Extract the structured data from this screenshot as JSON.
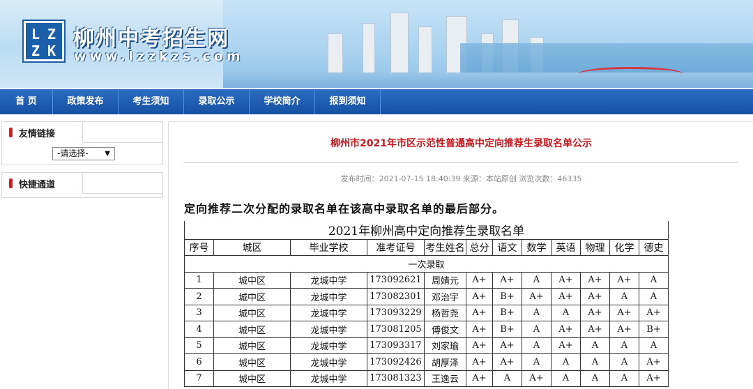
{
  "header": {
    "logo_letters": [
      "L",
      "Z",
      "Z",
      "K"
    ],
    "site_title": "柳州中考招生网",
    "site_url": "www.lzzkzs.com"
  },
  "nav": {
    "items": [
      {
        "label": "首 页"
      },
      {
        "label": "政策发布"
      },
      {
        "label": "考生须知"
      },
      {
        "label": "录取公示"
      },
      {
        "label": "学校简介"
      },
      {
        "label": "报到须知"
      }
    ]
  },
  "sidebar": {
    "links_title": "友情链接",
    "links_select_value": "-请选择-",
    "quick_title": "快捷通道"
  },
  "article": {
    "title": "柳州市2021年市区示范性普通高中定向推荐生录取名单公示",
    "meta": "发布时间：2021-07-15 18:40:39   来源：本站原创   浏览次数：46335",
    "intro": "定向推荐二次分配的录取名单在该高中录取名单的最后部分。",
    "table": {
      "caption": "2021年柳州高中定向推荐生录取名单",
      "headers": [
        "序号",
        "城区",
        "毕业学校",
        "准考证号",
        "考生姓名",
        "总分",
        "语文",
        "数学",
        "英语",
        "物理",
        "化学",
        "德史"
      ],
      "section_label": "一次录取",
      "rows": [
        [
          "1",
          "城中区",
          "龙城中学",
          "173092621",
          "周婧元",
          "A+",
          "A+",
          "A",
          "A+",
          "A+",
          "A+",
          "A"
        ],
        [
          "2",
          "城中区",
          "龙城中学",
          "173082301",
          "邓治宇",
          "A+",
          "B+",
          "A+",
          "A+",
          "A+",
          "A",
          "A"
        ],
        [
          "3",
          "城中区",
          "龙城中学",
          "173093229",
          "杨哲尧",
          "A+",
          "B+",
          "A",
          "A",
          "A+",
          "A+",
          "A+"
        ],
        [
          "4",
          "城中区",
          "龙城中学",
          "173081205",
          "傅俊文",
          "A+",
          "B+",
          "A",
          "A+",
          "A+",
          "A+",
          "B+"
        ],
        [
          "5",
          "城中区",
          "龙城中学",
          "173093317",
          "刘家瑜",
          "A+",
          "A+",
          "A",
          "A+",
          "A",
          "A",
          "A"
        ],
        [
          "6",
          "城中区",
          "龙城中学",
          "173092426",
          "胡厚泽",
          "A+",
          "A+",
          "A",
          "A",
          "A",
          "A",
          "A+"
        ],
        [
          "7",
          "城中区",
          "龙城中学",
          "173081323",
          "王逸云",
          "A+",
          "A",
          "A+",
          "A",
          "A",
          "A",
          "A+"
        ]
      ]
    }
  },
  "colors": {
    "nav_bg": "#1e5db4",
    "title_red": "#c8161d",
    "accent_bar": "#d21e1e"
  }
}
